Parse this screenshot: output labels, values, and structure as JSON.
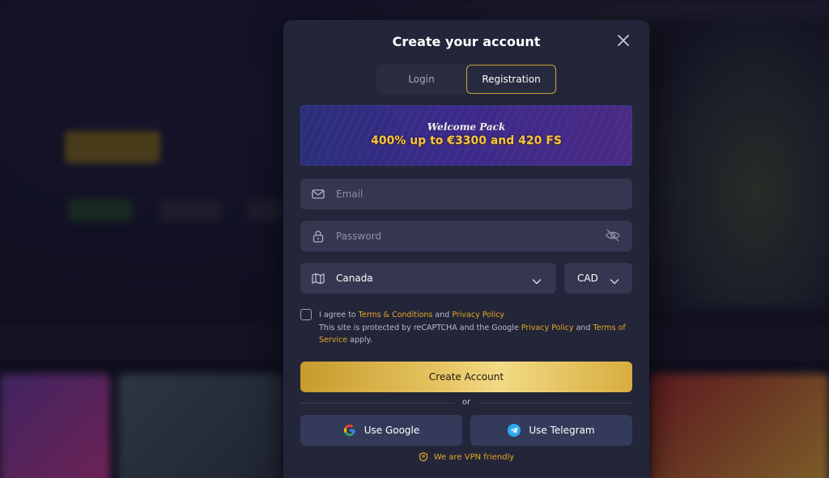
{
  "modal": {
    "title": "Create your account",
    "close_icon": "close-icon"
  },
  "tabs": [
    {
      "label": "Login",
      "active": false
    },
    {
      "label": "Registration",
      "active": true
    }
  ],
  "banner": {
    "subtitle": "Welcome Pack",
    "offer": "400% up to €3300 and 420 FS"
  },
  "form": {
    "email": {
      "placeholder": "Email",
      "icon": "mail-icon"
    },
    "password": {
      "placeholder": "Password",
      "icon": "lock-icon",
      "toggle_icon": "eye-off-icon"
    },
    "country": {
      "value": "Canada",
      "icon": "map-icon"
    },
    "currency": {
      "value": "CAD"
    }
  },
  "consent": {
    "agree_prefix": "I agree to",
    "terms_link": "Terms & Conditions",
    "and": "and",
    "privacy_link": "Privacy Policy",
    "recaptcha_prefix": "This site is protected by reCAPTCHA and the Google",
    "google_privacy_link": "Privacy Policy",
    "and2": "and",
    "tos_link": "Terms of Service",
    "apply": "apply."
  },
  "actions": {
    "create_account": "Create Account",
    "or": "or",
    "google": "Use Google",
    "telegram": "Use Telegram",
    "vpn_note": "We are VPN friendly"
  },
  "colors": {
    "accent": "#e3a823",
    "modal_bg": "#232539",
    "field_bg": "#34374f",
    "social_bg": "#343a5a"
  }
}
